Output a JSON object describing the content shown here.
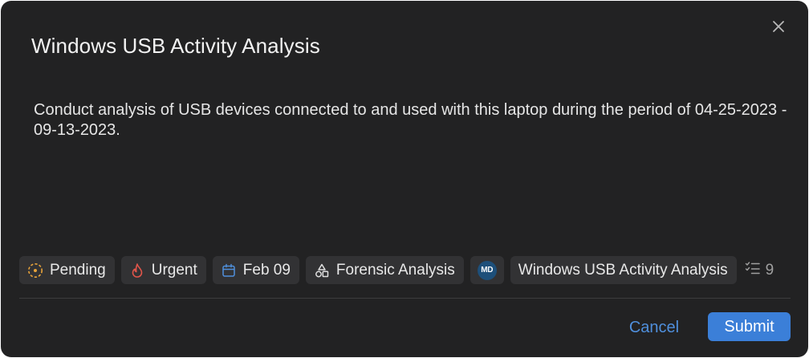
{
  "dialog": {
    "title": "Windows USB Activity Analysis",
    "description": "Conduct analysis of USB devices connected to and used with this laptop during the period of 04-25-2023 - 09-13-2023.",
    "close_icon": "close-icon"
  },
  "properties": {
    "status": {
      "label": "Pending",
      "icon": "pending-status-icon",
      "color": "#e8a33a"
    },
    "priority": {
      "label": "Urgent",
      "icon": "flame-icon",
      "color": "#e0554a"
    },
    "due_date": {
      "label": "Feb 09",
      "icon": "calendar-icon",
      "color": "#4f8fdc"
    },
    "category": {
      "label": "Forensic Analysis",
      "icon": "shapes-icon"
    },
    "assignee": {
      "initials": "MD",
      "color": "#1d4f7a"
    },
    "parent": {
      "label": "Windows USB Activity Analysis"
    },
    "subtasks": {
      "count": "9",
      "icon": "checklist-icon"
    }
  },
  "footer": {
    "cancel_label": "Cancel",
    "submit_label": "Submit"
  },
  "colors": {
    "background": "#222223",
    "chip": "#323234",
    "accent": "#3b7fd8"
  }
}
